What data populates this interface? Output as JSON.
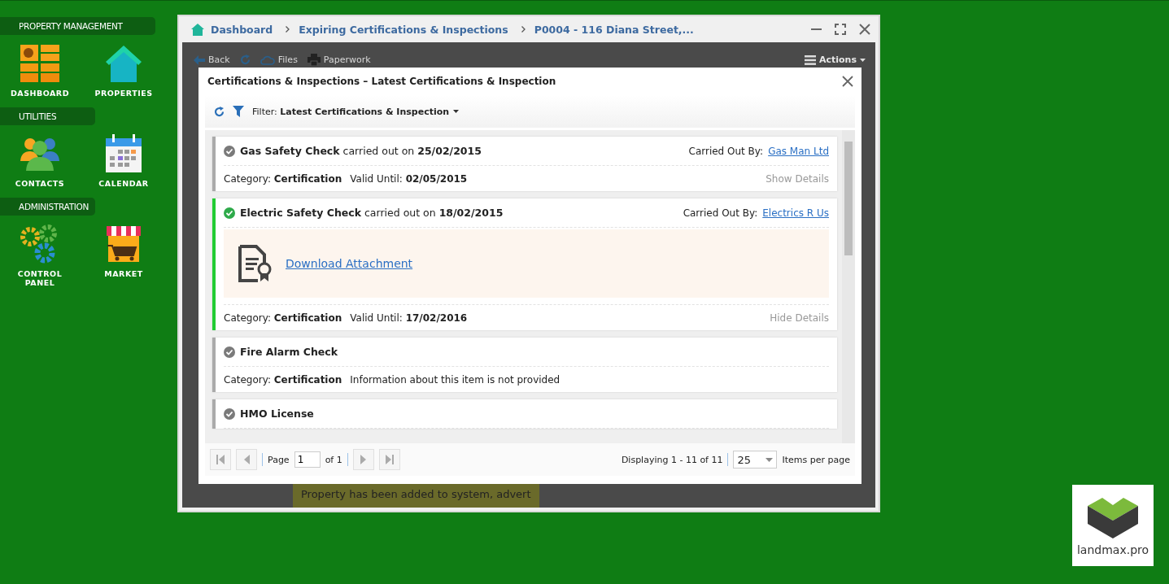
{
  "sidebar": [
    {
      "label": "PROPERTY MANAGEMENT",
      "items": [
        {
          "label": "DASHBOARD"
        },
        {
          "label": "PROPERTIES"
        }
      ]
    },
    {
      "label": "UTILITIES",
      "items": [
        {
          "label": "CONTACTS"
        },
        {
          "label": "CALENDAR"
        }
      ]
    },
    {
      "label": "ADMINISTRATION",
      "items": [
        {
          "label": "CONTROL PANEL"
        },
        {
          "label": "MARKET"
        }
      ]
    }
  ],
  "window": {
    "breadcrumbs": [
      "Dashboard",
      "Expiring Certifications & Inspections",
      "P0004 - 116 Diana Street,..."
    ]
  },
  "toolbar": {
    "items": [
      "Back",
      "Files",
      "Paperwork"
    ],
    "actions": "Actions"
  },
  "background_note": "Property has been added to system, advert",
  "modal": {
    "title": "Certifications & Inspections  –  Latest Certifications & Inspection",
    "filter": "Filter: **Latest Certifications & Inspection**",
    "cards": [
      {
        "verified": false,
        "heading": "**Gas Safety Check** carried out on **25/02/2015**",
        "by_label": "Carried Out By:",
        "by": "Gas Man Ltd",
        "expanded": false,
        "category": "Category: **Certification**",
        "detail": "Valid Until: **02/05/2015**",
        "toggle": "Show Details"
      },
      {
        "verified": true,
        "heading": "**Electric Safety Check** carried out on **18/02/2015**",
        "by_label": "Carried Out By:",
        "by": "Electrics R Us",
        "expanded": true,
        "attachment": "Download Attachment",
        "category": "Category: **Certification**",
        "detail": "Valid Until: **17/02/2016**",
        "toggle": "Hide Details"
      },
      {
        "verified": false,
        "heading": "**Fire Alarm Check**",
        "category": "Category: **Certification**",
        "detail": "Information about this item is not provided"
      },
      {
        "verified": false,
        "heading": "**HMO License**"
      }
    ],
    "pager": {
      "page_label": "Page",
      "page": "1",
      "of": "of 1",
      "displaying": "Displaying 1 - 11 of 11",
      "per_page": "25",
      "per_page_label": "Items per page"
    }
  },
  "brand": "landmax.pro"
}
